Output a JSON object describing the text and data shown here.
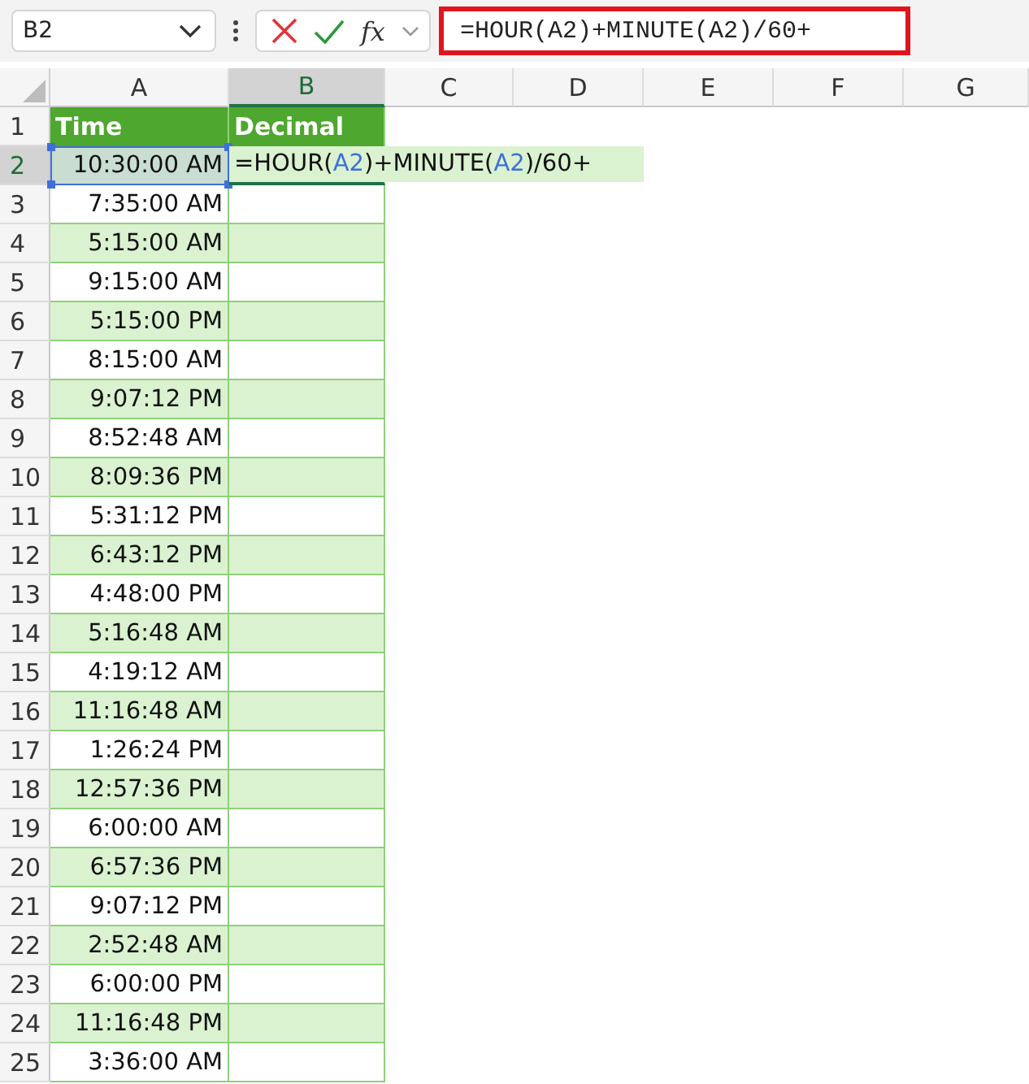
{
  "name_box": "B2",
  "function_label": "fx",
  "formula_bar": {
    "value": "=HOUR(A2)+MINUTE(A2)/60+"
  },
  "columns": [
    {
      "label": "A",
      "selected": false
    },
    {
      "label": "B",
      "selected": true
    },
    {
      "label": "C",
      "selected": false
    },
    {
      "label": "D",
      "selected": false
    },
    {
      "label": "E",
      "selected": false
    },
    {
      "label": "F",
      "selected": false
    },
    {
      "label": "G",
      "selected": false
    }
  ],
  "header_row": {
    "number": "1",
    "selected": false,
    "cells": [
      "Time",
      "Decimal"
    ]
  },
  "edit_row": {
    "number": "2",
    "selected": true,
    "time": "10:30:00 AM",
    "formula": [
      {
        "text": "=HOUR(",
        "ref": false
      },
      {
        "text": "A2",
        "ref": true
      },
      {
        "text": ")+MINUTE(",
        "ref": false
      },
      {
        "text": "A2",
        "ref": true
      },
      {
        "text": ")/60+",
        "ref": false
      }
    ]
  },
  "rows": [
    {
      "number": "3",
      "selected": false,
      "shaded": false,
      "time": "7:35:00 AM"
    },
    {
      "number": "4",
      "selected": false,
      "shaded": true,
      "time": "5:15:00 AM"
    },
    {
      "number": "5",
      "selected": false,
      "shaded": false,
      "time": "9:15:00 AM"
    },
    {
      "number": "6",
      "selected": false,
      "shaded": true,
      "time": "5:15:00 PM"
    },
    {
      "number": "7",
      "selected": false,
      "shaded": false,
      "time": "8:15:00 AM"
    },
    {
      "number": "8",
      "selected": false,
      "shaded": true,
      "time": "9:07:12 PM"
    },
    {
      "number": "9",
      "selected": false,
      "shaded": false,
      "time": "8:52:48 AM"
    },
    {
      "number": "10",
      "selected": false,
      "shaded": true,
      "time": "8:09:36 PM"
    },
    {
      "number": "11",
      "selected": false,
      "shaded": false,
      "time": "5:31:12 PM"
    },
    {
      "number": "12",
      "selected": false,
      "shaded": true,
      "time": "6:43:12 PM"
    },
    {
      "number": "13",
      "selected": false,
      "shaded": false,
      "time": "4:48:00 PM"
    },
    {
      "number": "14",
      "selected": false,
      "shaded": true,
      "time": "5:16:48 AM"
    },
    {
      "number": "15",
      "selected": false,
      "shaded": false,
      "time": "4:19:12 AM"
    },
    {
      "number": "16",
      "selected": false,
      "shaded": true,
      "time": "11:16:48 AM"
    },
    {
      "number": "17",
      "selected": false,
      "shaded": false,
      "time": "1:26:24 PM"
    },
    {
      "number": "18",
      "selected": false,
      "shaded": true,
      "time": "12:57:36 PM"
    },
    {
      "number": "19",
      "selected": false,
      "shaded": false,
      "time": "6:00:00 AM"
    },
    {
      "number": "20",
      "selected": false,
      "shaded": true,
      "time": "6:57:36 PM"
    },
    {
      "number": "21",
      "selected": false,
      "shaded": false,
      "time": "9:07:12 PM"
    },
    {
      "number": "22",
      "selected": false,
      "shaded": true,
      "time": "2:52:48 AM"
    },
    {
      "number": "23",
      "selected": false,
      "shaded": false,
      "time": "6:00:00 PM"
    },
    {
      "number": "24",
      "selected": false,
      "shaded": true,
      "time": "11:16:48 PM"
    },
    {
      "number": "25",
      "selected": false,
      "shaded": false,
      "time": "3:36:00 AM"
    }
  ]
}
